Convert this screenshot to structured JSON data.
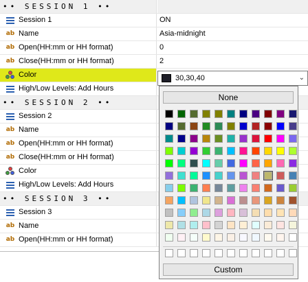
{
  "rows": [
    {
      "type": "section",
      "label": "•• SESSION 1 ••",
      "value": ""
    },
    {
      "type": "prop",
      "icon": "list-icon",
      "label": "Session 1",
      "value": "ON"
    },
    {
      "type": "prop",
      "icon": "ab-icon",
      "label": "Name",
      "value": "Asia-midnight"
    },
    {
      "type": "prop",
      "icon": "ab-icon",
      "label": "Open(HH:mm or HH format)",
      "value": "0"
    },
    {
      "type": "prop",
      "icon": "ab-icon",
      "label": "Close(HH:mm or HH format)",
      "value": "2"
    },
    {
      "type": "prop",
      "icon": "palette-icon",
      "label": "Color",
      "value": "",
      "highlight": true
    },
    {
      "type": "prop",
      "icon": "list-icon",
      "label": "High/Low Levels: Add Hours",
      "value": ""
    },
    {
      "type": "section",
      "label": "•• SESSION 2 ••",
      "value": ""
    },
    {
      "type": "prop",
      "icon": "list-icon",
      "label": "Session 2",
      "value": ""
    },
    {
      "type": "prop",
      "icon": "ab-icon",
      "label": "Name",
      "value": ""
    },
    {
      "type": "prop",
      "icon": "ab-icon",
      "label": "Open(HH:mm or HH format)",
      "value": ""
    },
    {
      "type": "prop",
      "icon": "ab-icon",
      "label": "Close(HH:mm or HH format)",
      "value": ""
    },
    {
      "type": "prop",
      "icon": "palette-icon",
      "label": "Color",
      "value": ""
    },
    {
      "type": "prop",
      "icon": "list-icon",
      "label": "High/Low Levels: Add Hours",
      "value": ""
    },
    {
      "type": "section",
      "label": "•• SESSION 3 ••",
      "value": ""
    },
    {
      "type": "prop",
      "icon": "list-icon",
      "label": "Session 3",
      "value": ""
    },
    {
      "type": "prop",
      "icon": "ab-icon",
      "label": "Name",
      "value": ""
    },
    {
      "type": "prop",
      "icon": "ab-icon",
      "label": "Open(HH:mm or HH format)",
      "value": ""
    }
  ],
  "color_combo": {
    "value": "30,30,40",
    "swatch": "#1e1e28",
    "arrow_icon": "chevron-down-icon"
  },
  "color_popup": {
    "none_label": "None",
    "custom_label": "Custom",
    "palette": [
      [
        "#000000",
        "#006400",
        "#556b2f",
        "#808000",
        "#808000",
        "#008080",
        "#000080",
        "#4b0082",
        "#800000",
        "#800080",
        "#191970"
      ],
      [
        "#000080",
        "#556b2f",
        "#8b4513",
        "#228b22",
        "#2e8b57",
        "#808000",
        "#0000cd",
        "#b22222",
        "#8b0000",
        "#0000ff",
        "#483d8b"
      ],
      [
        "#008b8b",
        "#00008b",
        "#8b008b",
        "#b8860b",
        "#6b8e23",
        "#20b2aa",
        "#9932cc",
        "#dc143c",
        "#ff0000",
        "#ff00ff",
        "#7b68ee"
      ],
      [
        "#7fff00",
        "#00ced1",
        "#9400d3",
        "#32cd32",
        "#3cb371",
        "#00bfff",
        "#ff1493",
        "#ff4500",
        "#ffd700",
        "#ffff00",
        "#adff2f"
      ],
      [
        "#00ff00",
        "#00ff7f",
        "#2f4f4f",
        "#00ffff",
        "#66cdaa",
        "#4169e1",
        "#ff00ff",
        "#ff6347",
        "#ffa500",
        "#ff69b4",
        "#8a2be2"
      ],
      [
        "#9370db",
        "#40e0d0",
        "#00fa9a",
        "#1e90ff",
        "#48d1cc",
        "#6495ed",
        "#ba55d3",
        "#f08080",
        "#bdb76b",
        "#cd5c5c",
        "#4682b4"
      ],
      [
        "#87ceeb",
        "#7cfc00",
        "#3cb371",
        "#ff7f50",
        "#778899",
        "#5f9ea0",
        "#ee82ee",
        "#fa8072",
        "#d2691e",
        "#6a5acd",
        "#9acd32"
      ],
      [
        "#f4a460",
        "#00bfff",
        "#b0c4de",
        "#f0e68c",
        "#d2b48c",
        "#da70d6",
        "#bc8f8f",
        "#e9967a",
        "#daa520",
        "#cd853f",
        "#a0522d"
      ],
      [
        "#c0c0c0",
        "#87cefa",
        "#90ee90",
        "#add8e6",
        "#dda0dd",
        "#ffb6c1",
        "#d8bfd8",
        "#f5deb3",
        "#ffdead",
        "#ffe4b5",
        "#ffdab9"
      ],
      [
        "#eee8aa",
        "#b0e0e6",
        "#afeeee",
        "#ffc0cb",
        "#d3d3d3",
        "#ffe4c4",
        "#ffefd5",
        "#e0ffff",
        "#faebd7",
        "#ffe4e1",
        "#f5f5dc"
      ],
      [
        "#f0fff0",
        "#fff0f5",
        "#f5fffa",
        "#fffacd",
        "#fdf5e6",
        "#faf0e6",
        "#f8f8ff",
        "#f0f8ff",
        "#fffaf0",
        "#fff5ee",
        "#ffffff"
      ]
    ],
    "recent": [
      "#ffffff",
      "#ffffff",
      "#ffffff",
      "#ffffff",
      "#ffffff",
      "#ffffff",
      "#ffffff",
      "#ffffff",
      "#ffffff",
      "#ffffff",
      "#ffffff"
    ],
    "selected_cell": [
      5,
      8
    ]
  }
}
